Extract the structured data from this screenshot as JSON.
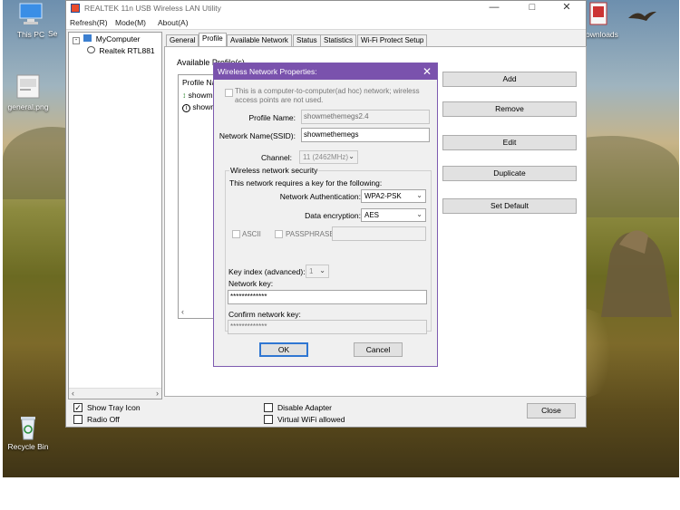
{
  "desktop": {
    "icons": [
      {
        "label": "This PC",
        "icon": "computer-icon"
      },
      {
        "label": "general.png",
        "icon": "image-file-icon"
      },
      {
        "label": "Recycle Bin",
        "icon": "recycle-bin-icon"
      },
      {
        "label": "Se",
        "icon": "partial-icon"
      },
      {
        "label": "ownloads",
        "icon": "downloads-icon"
      }
    ]
  },
  "window": {
    "title": "REALTEK 11n USB Wireless LAN Utility",
    "menu": [
      "Refresh(R)",
      "Mode(M)",
      "About(A)"
    ],
    "tree": {
      "root": "MyComputer",
      "child": "Realtek RTL881"
    },
    "tabs": [
      "General",
      "Profile",
      "Available Network",
      "Status",
      "Statistics",
      "Wi-Fi Protect Setup"
    ],
    "active_tab": "Profile",
    "profile": {
      "group_label": "Available Profile(s)",
      "list_header": "Profile Na",
      "list_items": [
        "showm",
        "showm"
      ],
      "buttons": [
        "Add",
        "Remove",
        "Edit",
        "Duplicate",
        "Set Default"
      ]
    },
    "bottom": {
      "show_tray_icon": "Show Tray Icon",
      "radio_off": "Radio Off",
      "disable_adapter": "Disable Adapter",
      "virtual_wifi": "Virtual WiFi allowed",
      "close": "Close"
    }
  },
  "dialog": {
    "title": "Wireless Network Properties:",
    "adhoc_text": "This is a computer-to-computer(ad hoc) network; wireless access points are not used.",
    "profile_name_label": "Profile Name:",
    "profile_name_value": "showmethemegs2.4",
    "ssid_label": "Network Name(SSID):",
    "ssid_value": "showmethemegs",
    "channel_label": "Channel:",
    "channel_value": "11 (2462MHz)",
    "security_group": "Wireless network security",
    "key_required_text": "This network requires a key for the following:",
    "auth_label": "Network Authentication:",
    "auth_value": "WPA2-PSK",
    "encryption_label": "Data encryption:",
    "encryption_value": "AES",
    "ascii_label": "ASCII",
    "passphrase_label": "PASSPHRASE",
    "key_index_label": "Key index (advanced):",
    "key_index_value": "1",
    "network_key_label": "Network key:",
    "network_key_value": "*************",
    "confirm_key_label": "Confirm network key:",
    "confirm_key_value": "*************",
    "ok": "OK",
    "cancel": "Cancel"
  }
}
